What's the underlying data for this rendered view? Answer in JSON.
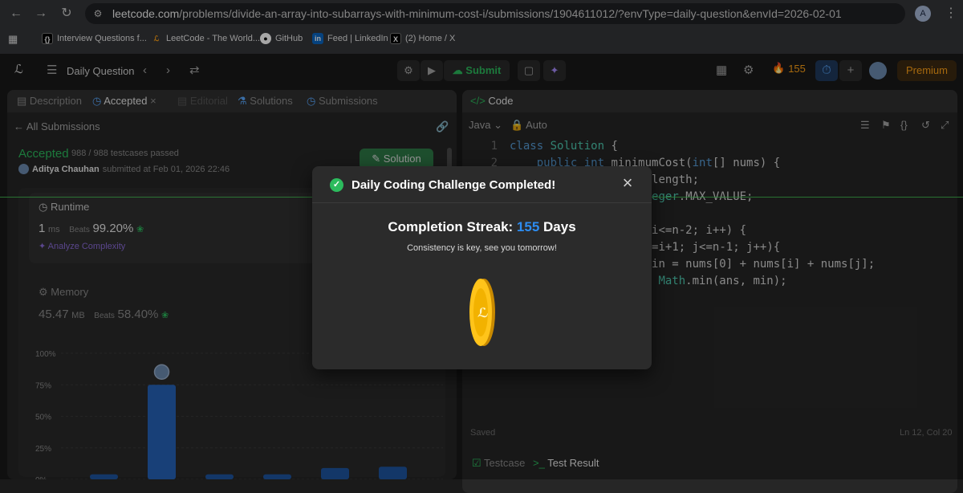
{
  "browser": {
    "url_domain": "leetcode.com",
    "url_path": "/problems/divide-an-array-into-subarrays-with-minimum-cost-i/submissions/1904611012/?envType=daily-question&envId=2026-02-01",
    "profile_initial": "A",
    "bookmarks": [
      {
        "label": "Interview Questions f...",
        "icon": "code-icon",
        "color": "#000000"
      },
      {
        "label": "LeetCode - The World...",
        "icon": "leetcode-icon",
        "color": "#ffa116"
      },
      {
        "label": "GitHub",
        "icon": "github-icon",
        "color": "#ffffff"
      },
      {
        "label": "Feed | LinkedIn",
        "icon": "linkedin-icon",
        "color": "#0a66c2"
      },
      {
        "label": "(2) Home / X",
        "icon": "x-icon",
        "color": "#000000"
      }
    ]
  },
  "app": {
    "problem_list_label": "Daily Question",
    "submit_label": "Submit",
    "streak_count": "155",
    "premium_label": "Premium",
    "left_tabs": [
      "Description",
      "Accepted",
      "Editorial",
      "Solutions",
      "Submissions"
    ],
    "all_submissions_label": "All Submissions",
    "status": "Accepted",
    "testcases": "988 / 988 testcases passed",
    "submitter_name": "Aditya Chauhan",
    "submitted_at": "submitted at Feb 01, 2026 22:46",
    "solution_label": "Solution",
    "runtime": {
      "label": "Runtime",
      "value": "1",
      "unit": "ms",
      "beats_label": "Beats",
      "beats": "99.20%",
      "analyze": "Analyze Complexity"
    },
    "memory": {
      "label": "Memory",
      "value": "45.47",
      "unit": "MB",
      "beats_label": "Beats",
      "beats": "58.40%"
    },
    "code_tab": "Code",
    "language": "Java",
    "auto_label": "Auto",
    "code_lines": [
      "class Solution {",
      "    public int minimumCost(int[] nums) {",
      "        int n = nums.length;",
      "        int ans = Integer.MAX_VALUE;",
      "",
      "        for(int i=1; i<=n-2; i++) {",
      "            for(int j=i+1; j<=n-1; j++){",
      "                int min = nums[0] + nums[i] + nums[j];",
      "                ans = Math.min(ans, min);"
    ],
    "saved_label": "Saved",
    "cursor_pos": "Ln 12, Col 20",
    "testcase_tab": "Testcase",
    "test_result_tab": "Test Result",
    "accent_green": "#2cbb5d",
    "accent_orange": "#ffa116"
  },
  "chart_data": {
    "type": "bar",
    "y_ticks": [
      "100%",
      "75%",
      "50%",
      "25%",
      "0%"
    ],
    "ylim": [
      0,
      100
    ],
    "values": [
      4,
      75,
      4,
      4,
      9,
      10
    ],
    "highlight_index": 1
  },
  "modal": {
    "title": "Daily Coding Challenge Completed!",
    "streak_label": "Completion Streak:",
    "streak_value": "155",
    "streak_unit": "Days",
    "tagline": "Consistency is key, see you tomorrow!"
  }
}
